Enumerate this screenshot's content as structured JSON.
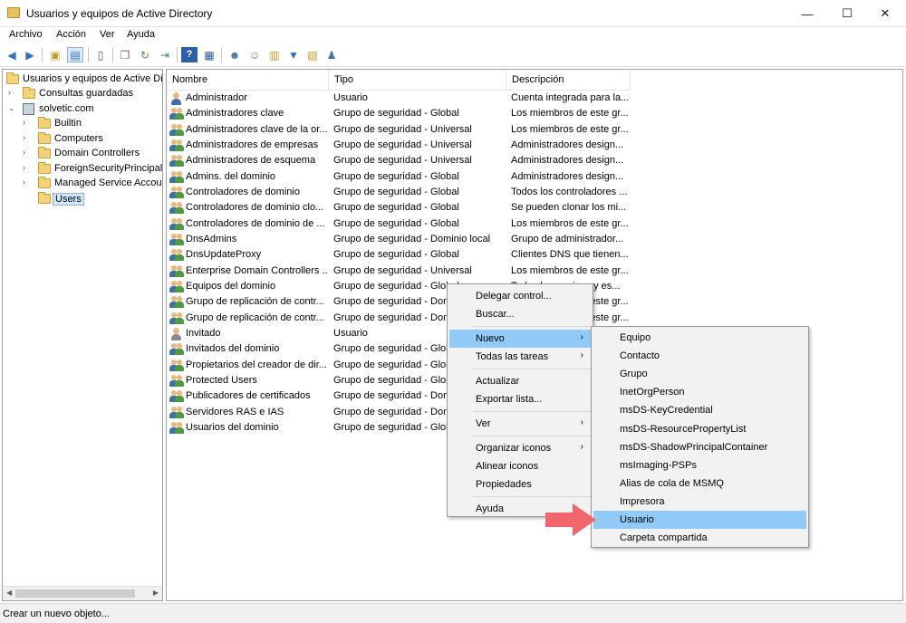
{
  "window": {
    "title": "Usuarios y equipos de Active Directory",
    "controls": {
      "minimize": "—",
      "maximize": "☐",
      "close": "✕"
    }
  },
  "menubar": [
    "Archivo",
    "Acción",
    "Ver",
    "Ayuda"
  ],
  "toolbar": {
    "icons": [
      "back-icon",
      "forward-icon",
      "up-folder-icon",
      "show-console-tree-icon",
      "properties-icon",
      "copy-icon",
      "refresh-icon",
      "export-list-icon",
      "help-icon",
      "console-icon",
      "new-user-icon",
      "new-group-icon",
      "new-ou-icon",
      "filter-icon",
      "add-to-group-icon",
      "delegate-icon"
    ]
  },
  "tree": {
    "root": "Usuarios y equipos de Active Directory",
    "items": [
      {
        "label": "Consultas guardadas",
        "level": 1,
        "expander": "›"
      },
      {
        "label": "solvetic.com",
        "level": 1,
        "expander": "⌄"
      },
      {
        "label": "Builtin",
        "level": 2,
        "expander": "›"
      },
      {
        "label": "Computers",
        "level": 2,
        "expander": "›"
      },
      {
        "label": "Domain Controllers",
        "level": 2,
        "expander": "›"
      },
      {
        "label": "ForeignSecurityPrincipals",
        "level": 2,
        "expander": "›"
      },
      {
        "label": "Managed Service Accounts",
        "level": 2,
        "expander": "›"
      },
      {
        "label": "Users",
        "level": 2,
        "expander": "",
        "selected": true
      }
    ]
  },
  "list": {
    "columns": [
      "Nombre",
      "Tipo",
      "Descripción"
    ],
    "rows": [
      {
        "name": "Administrador",
        "type": "Usuario",
        "desc": "Cuenta integrada para la...",
        "icon": "user"
      },
      {
        "name": "Administradores clave",
        "type": "Grupo de seguridad - Global",
        "desc": "Los miembros de este gr...",
        "icon": "group"
      },
      {
        "name": "Administradores clave de la or...",
        "type": "Grupo de seguridad - Universal",
        "desc": "Los miembros de este gr...",
        "icon": "group"
      },
      {
        "name": "Administradores de empresas",
        "type": "Grupo de seguridad - Universal",
        "desc": "Administradores design...",
        "icon": "group"
      },
      {
        "name": "Administradores de esquema",
        "type": "Grupo de seguridad - Universal",
        "desc": "Administradores design...",
        "icon": "group"
      },
      {
        "name": "Admins. del dominio",
        "type": "Grupo de seguridad - Global",
        "desc": "Administradores design...",
        "icon": "group"
      },
      {
        "name": "Controladores de dominio",
        "type": "Grupo de seguridad - Global",
        "desc": "Todos los controladores ...",
        "icon": "group"
      },
      {
        "name": "Controladores de dominio clo...",
        "type": "Grupo de seguridad - Global",
        "desc": "Se pueden clonar los mi...",
        "icon": "group"
      },
      {
        "name": "Controladores de dominio de ...",
        "type": "Grupo de seguridad - Global",
        "desc": "Los miembros de este gr...",
        "icon": "group"
      },
      {
        "name": "DnsAdmins",
        "type": "Grupo de seguridad - Dominio local",
        "desc": "Grupo de administrador...",
        "icon": "group"
      },
      {
        "name": "DnsUpdateProxy",
        "type": "Grupo de seguridad - Global",
        "desc": "Clientes DNS que tienen...",
        "icon": "group"
      },
      {
        "name": "Enterprise Domain Controllers ...",
        "type": "Grupo de seguridad - Universal",
        "desc": "Los miembros de este gr...",
        "icon": "group"
      },
      {
        "name": "Equipos del dominio",
        "type": "Grupo de seguridad - Global",
        "desc": "Todos los equipos y es...",
        "icon": "group"
      },
      {
        "name": "Grupo de replicación de contr...",
        "type": "Grupo de seguridad - Domi",
        "desc": "Los miembros de este gr...",
        "icon": "group"
      },
      {
        "name": "Grupo de replicación de contr...",
        "type": "Grupo de seguridad - Domi",
        "desc": "Los miembros de este gr...",
        "icon": "group"
      },
      {
        "name": "Invitado",
        "type": "Usuario",
        "desc": "",
        "icon": "user-disabled"
      },
      {
        "name": "Invitados del dominio",
        "type": "Grupo de seguridad - Glob",
        "desc": "",
        "icon": "group"
      },
      {
        "name": "Propietarios del creador de dir...",
        "type": "Grupo de seguridad - Glob",
        "desc": "",
        "icon": "group"
      },
      {
        "name": "Protected Users",
        "type": "Grupo de seguridad - Glob",
        "desc": "",
        "icon": "group"
      },
      {
        "name": "Publicadores de certificados",
        "type": "Grupo de seguridad - Dom",
        "desc": "",
        "icon": "group"
      },
      {
        "name": "Servidores RAS e IAS",
        "type": "Grupo de seguridad - Dom",
        "desc": "",
        "icon": "group"
      },
      {
        "name": "Usuarios del dominio",
        "type": "Grupo de seguridad - Glob",
        "desc": "",
        "icon": "group"
      }
    ]
  },
  "context_menu": {
    "items": [
      {
        "label": "Delegar control...",
        "arrow": ""
      },
      {
        "label": "Buscar...",
        "arrow": ""
      },
      {
        "separator": true
      },
      {
        "label": "Nuevo",
        "arrow": "›",
        "highlighted": true
      },
      {
        "label": "Todas las tareas",
        "arrow": "›"
      },
      {
        "separator": true
      },
      {
        "label": "Actualizar",
        "arrow": ""
      },
      {
        "label": "Exportar lista...",
        "arrow": ""
      },
      {
        "separator": true
      },
      {
        "label": "Ver",
        "arrow": "›"
      },
      {
        "separator": true
      },
      {
        "label": "Organizar iconos",
        "arrow": "›"
      },
      {
        "label": "Alinear iconos",
        "arrow": ""
      },
      {
        "label": "Propiedades",
        "arrow": ""
      },
      {
        "separator": true
      },
      {
        "label": "Ayuda",
        "arrow": ""
      }
    ]
  },
  "submenu_nuevo": {
    "items": [
      {
        "label": "Equipo"
      },
      {
        "label": "Contacto"
      },
      {
        "label": "Grupo"
      },
      {
        "label": "InetOrgPerson"
      },
      {
        "label": "msDS-KeyCredential"
      },
      {
        "label": "msDS-ResourcePropertyList"
      },
      {
        "label": "msDS-ShadowPrincipalContainer"
      },
      {
        "label": "msImaging-PSPs"
      },
      {
        "label": "Alias de cola de MSMQ"
      },
      {
        "label": "Impresora"
      },
      {
        "label": "Usuario",
        "highlighted": true
      },
      {
        "label": "Carpeta compartida"
      }
    ]
  },
  "statusbar": {
    "text": "Crear un nuevo objeto..."
  },
  "colors": {
    "highlight": "#91c9f7",
    "annotation_arrow": "#f2666b"
  }
}
